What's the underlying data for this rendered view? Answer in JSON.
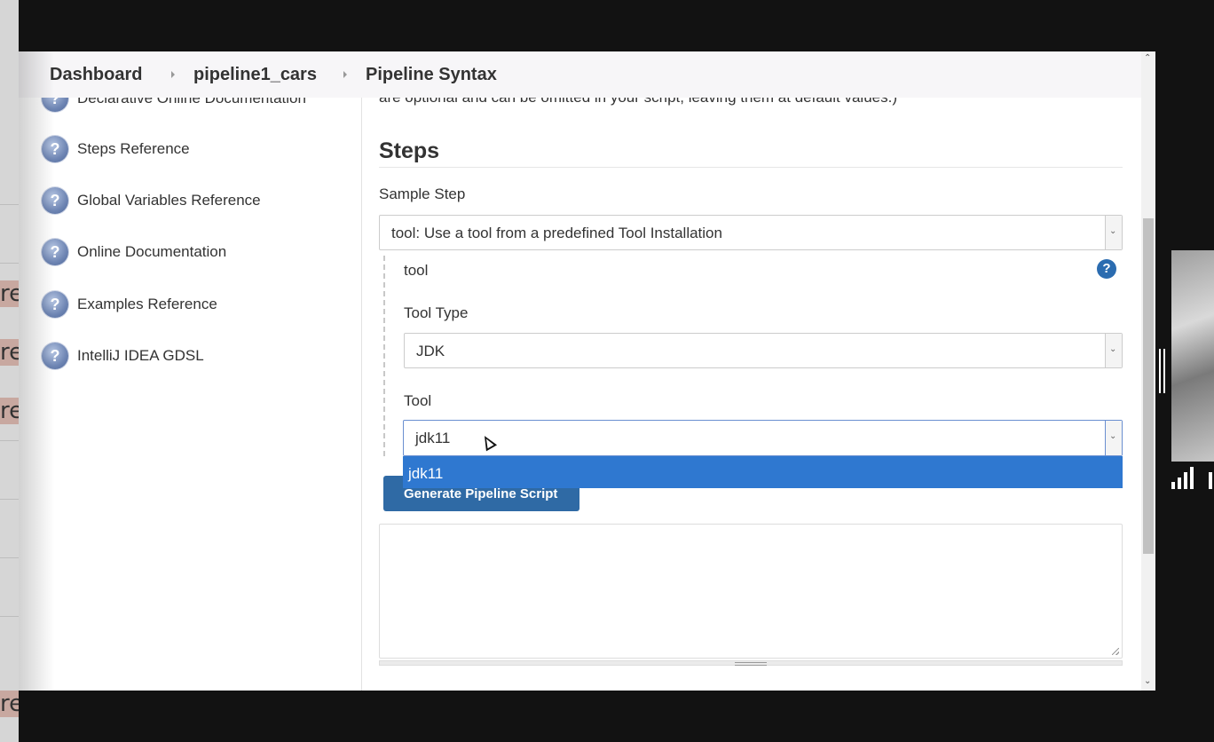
{
  "breadcrumb": {
    "items": [
      "Dashboard",
      "pipeline1_cars",
      "Pipeline Syntax"
    ]
  },
  "sidebar": {
    "items": [
      {
        "label": "Declarative Online Documentation",
        "icon": "help-circle-icon"
      },
      {
        "label": "Steps Reference",
        "icon": "help-circle-icon"
      },
      {
        "label": "Global Variables Reference",
        "icon": "help-circle-icon"
      },
      {
        "label": "Online Documentation",
        "icon": "help-circle-icon"
      },
      {
        "label": "Examples Reference",
        "icon": "help-circle-icon"
      },
      {
        "label": "IntelliJ IDEA GDSL",
        "icon": "help-circle-icon"
      }
    ]
  },
  "main": {
    "intro_text": "are optional and can be omitted in your script, leaving them at default values.)",
    "steps_title": "Steps",
    "sample_step_label": "Sample Step",
    "sample_step_value": "tool: Use a tool from a predefined Tool Installation",
    "tool_section_title": "tool",
    "tool_type_label": "Tool Type",
    "tool_type_value": "JDK",
    "tool_label": "Tool",
    "tool_value": "jdk11",
    "dropdown_options": [
      "jdk11"
    ],
    "generate_button": "Generate Pipeline Script",
    "script_output": ""
  },
  "colors": {
    "accent": "#2f6aa5",
    "dropdown_highlight": "#2f78d0",
    "header_bg": "#f7f6f8"
  }
}
